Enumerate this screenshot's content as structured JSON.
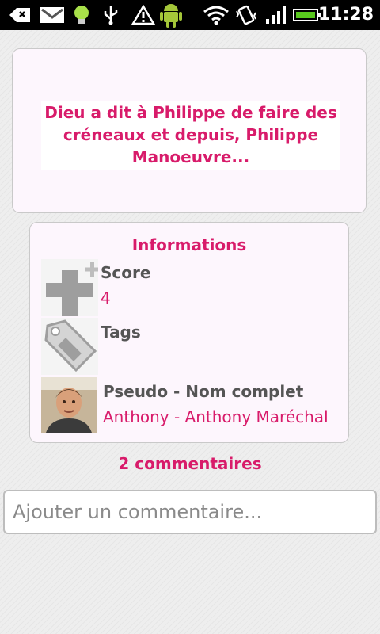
{
  "status_bar": {
    "time": "11:28",
    "icons": [
      "back-icon",
      "gmail-icon",
      "bulb-icon",
      "usb-icon",
      "warning-icon",
      "android-icon",
      "wifi-icon",
      "vibrate-icon",
      "signal-icon",
      "battery-icon"
    ]
  },
  "quote": {
    "text": "Dieu a dit à Philippe de faire des créneaux et depuis, Philippe Manoeuvre..."
  },
  "info": {
    "title": "Informations",
    "score_label": "Score",
    "score_value": "4",
    "tags_label": "Tags",
    "tags_value": "",
    "author_label": "Pseudo - Nom complet",
    "author_value": "Anthony - Anthony Maréchal"
  },
  "comments": {
    "count_label": "2 commentaires",
    "input_placeholder": "Ajouter un commentaire..."
  },
  "colors": {
    "accent": "#d81b6a",
    "label": "#555555",
    "card_bg": "#fdf6fd"
  }
}
